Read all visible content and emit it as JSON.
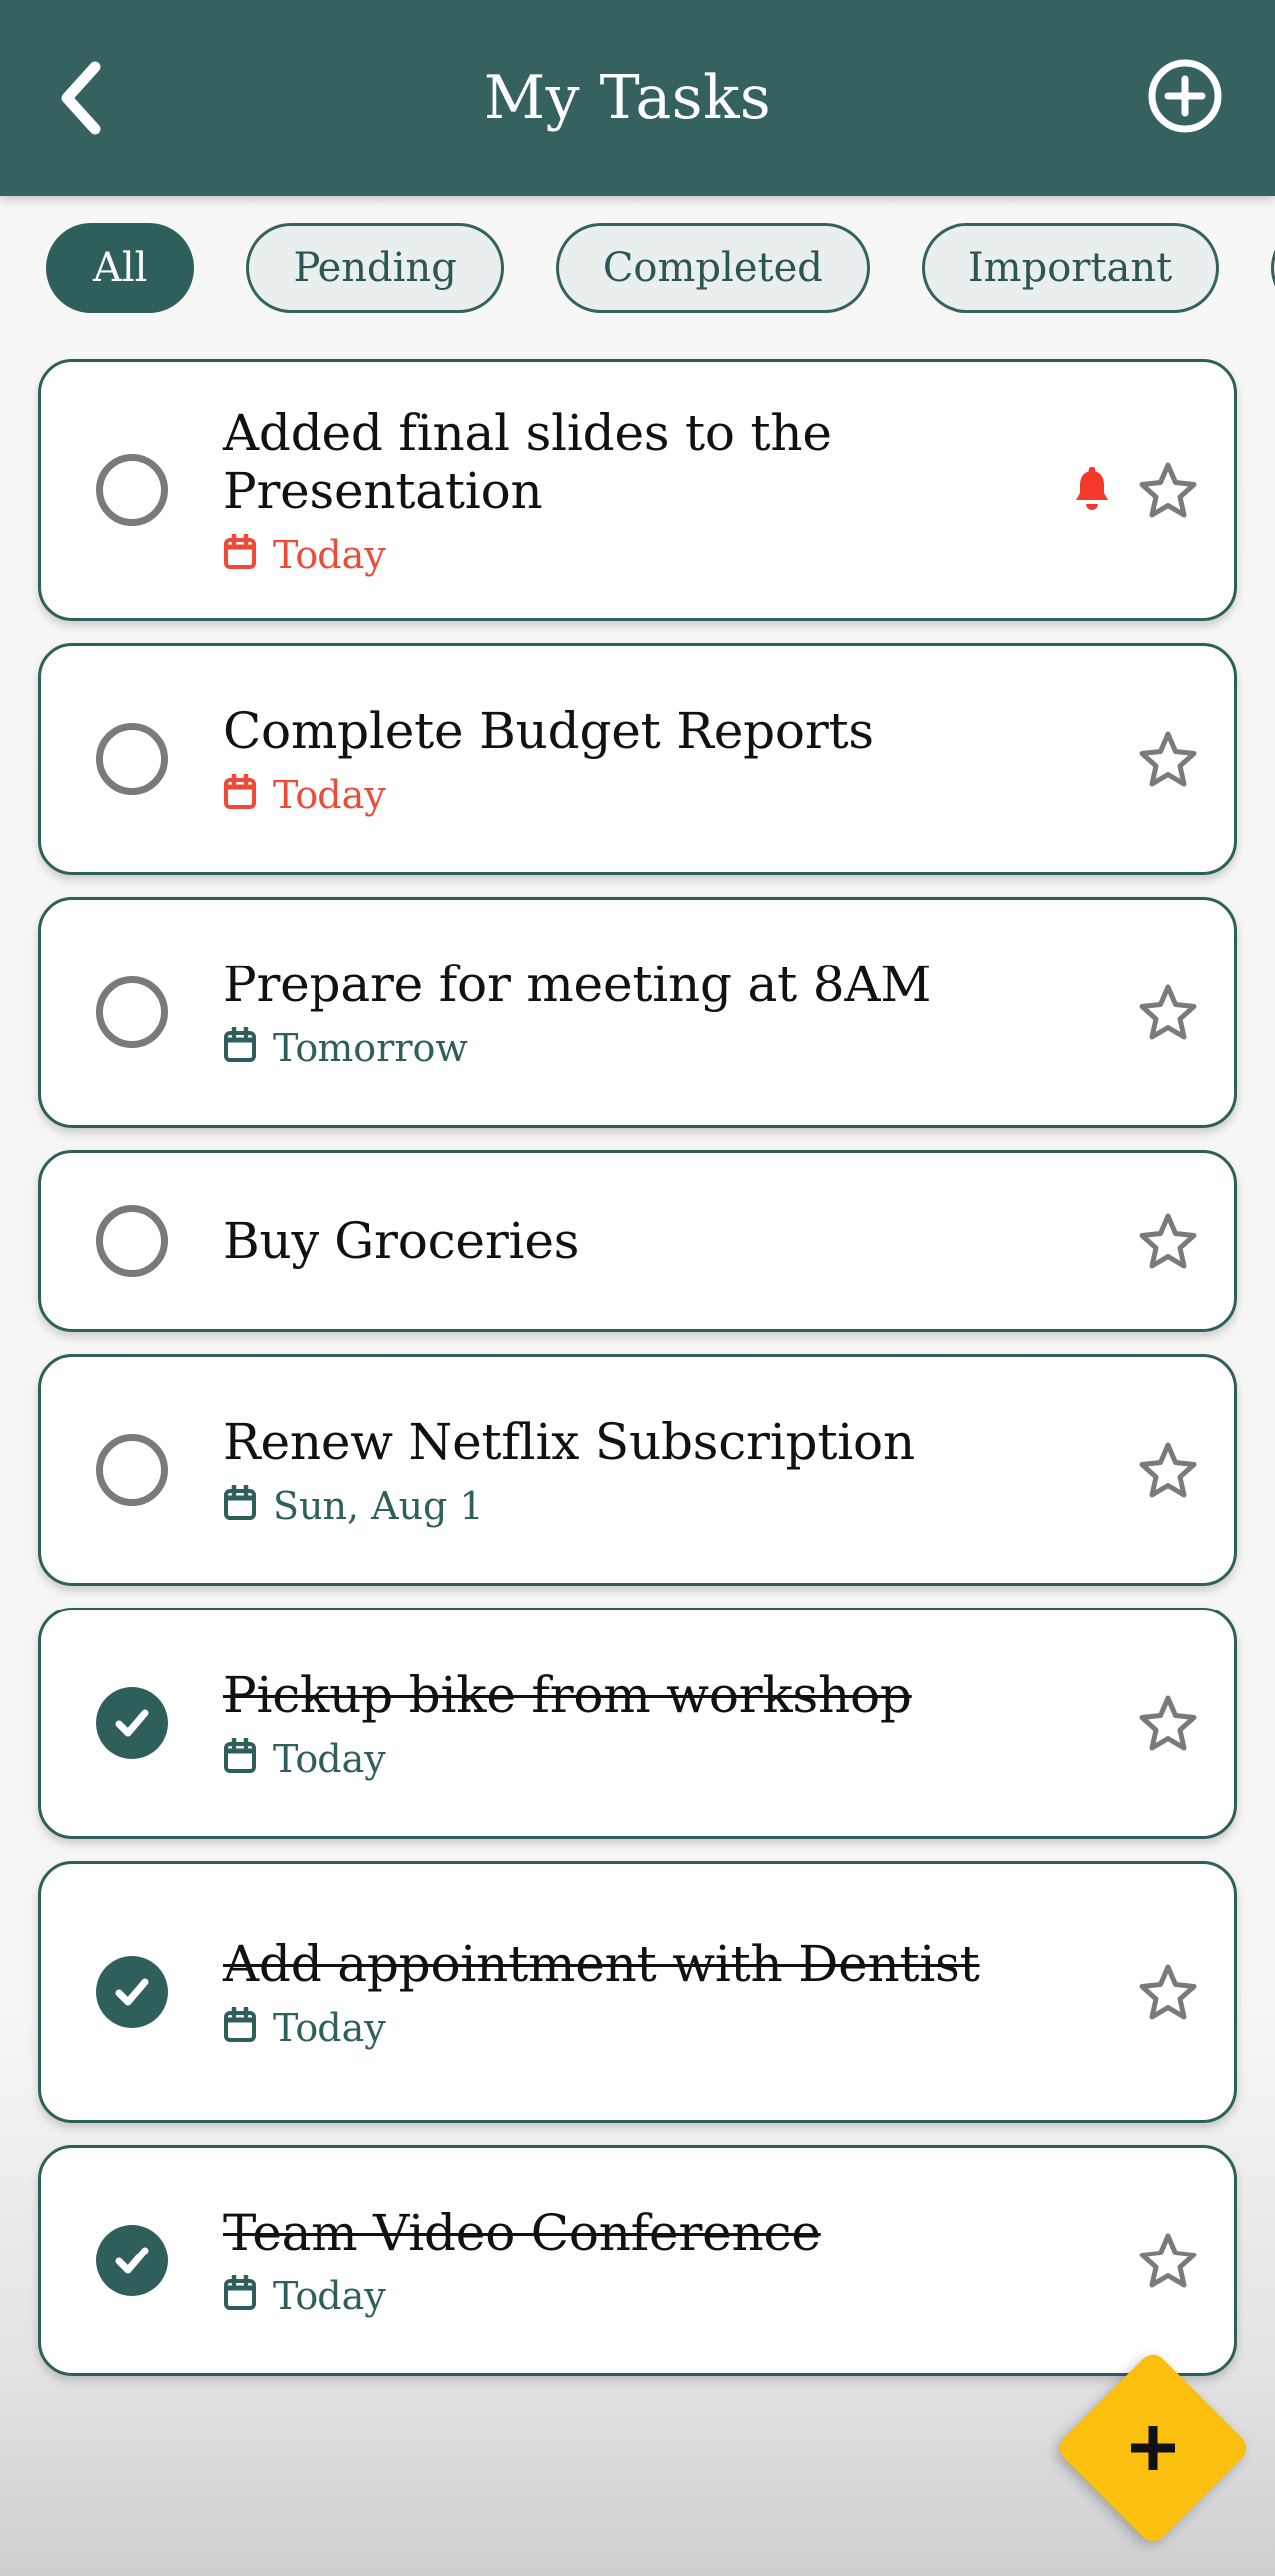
{
  "header": {
    "title": "My Tasks",
    "back_icon": "chevron-left-icon",
    "add_icon": "plus-circle-icon",
    "background_color": "#35625f"
  },
  "filters": {
    "chips": [
      {
        "label": "All",
        "selected": true
      },
      {
        "label": "Pending",
        "selected": false
      },
      {
        "label": "Completed",
        "selected": false
      },
      {
        "label": "Important",
        "selected": false
      },
      {
        "label": "",
        "selected": false
      }
    ]
  },
  "tasks": [
    {
      "title": "Added final slides to the Presentation",
      "date": "Today",
      "date_state": "due",
      "completed": false,
      "reminder": true,
      "starred": false,
      "size": "tall"
    },
    {
      "title": "Complete Budget Reports",
      "date": "Today",
      "date_state": "due",
      "completed": false,
      "reminder": false,
      "starred": false,
      "size": "normal"
    },
    {
      "title": "Prepare for meeting at 8AM",
      "date": "Tomorrow",
      "date_state": "soon",
      "completed": false,
      "reminder": false,
      "starred": false,
      "size": "normal"
    },
    {
      "title": "Buy Groceries",
      "date": "",
      "date_state": "none",
      "completed": false,
      "reminder": false,
      "starred": false,
      "size": "short"
    },
    {
      "title": "Renew Netflix Subscription",
      "date": "Sun, Aug 1",
      "date_state": "soon",
      "completed": false,
      "reminder": false,
      "starred": false,
      "size": "normal"
    },
    {
      "title": "Pickup bike from workshop",
      "date": "Today",
      "date_state": "soon",
      "completed": true,
      "reminder": false,
      "starred": false,
      "size": "normal"
    },
    {
      "title": "Add appointment with Dentist",
      "date": "Today",
      "date_state": "soon",
      "completed": true,
      "reminder": false,
      "starred": false,
      "size": "tall"
    },
    {
      "title": "Team Video Conference",
      "date": "Today",
      "date_state": "soon",
      "completed": true,
      "reminder": false,
      "starred": false,
      "size": "normal"
    }
  ],
  "fab": {
    "icon": "plus-icon",
    "color": "#fbbf10"
  },
  "colors": {
    "primary": "#2f5f5b",
    "appbar": "#35625f",
    "due": "#ee4a37",
    "star_outline": "#7a7a7a",
    "page_background": "#f7f7f6"
  }
}
